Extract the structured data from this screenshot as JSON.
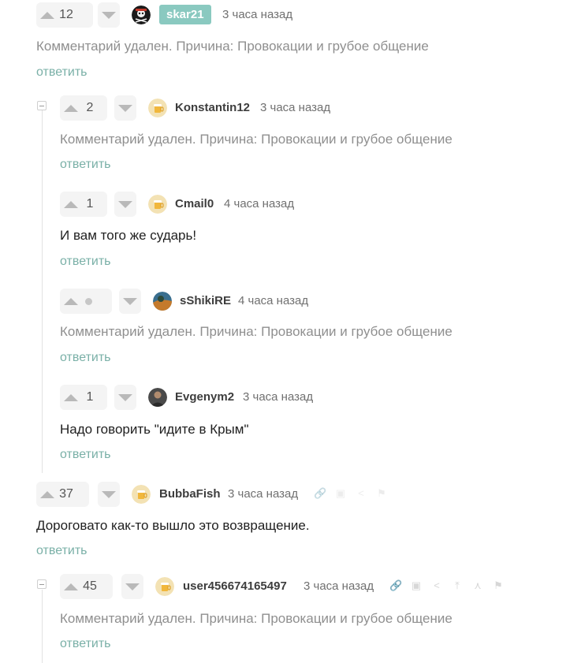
{
  "comments": [
    {
      "rating": "12",
      "user": "skar21",
      "time": "3 часа назад",
      "text": "Комментарий удален. Причина: Провокации и грубое общение",
      "reply": "ответить"
    },
    {
      "rating": "2",
      "user": "Konstantin12",
      "time": "3 часа назад",
      "text": "Комментарий удален. Причина: Провокации и грубое общение",
      "reply": "ответить"
    },
    {
      "rating": "1",
      "user": "Cmail0",
      "time": "4 часа назад",
      "text": "И вам того же сударь!",
      "reply": "ответить"
    },
    {
      "rating": "",
      "user": "sShikiRE",
      "time": "4 часа назад",
      "text": "Комментарий удален. Причина: Провокации и грубое общение",
      "reply": "ответить"
    },
    {
      "rating": "1",
      "user": "Evgenym2",
      "time": "3 часа назад",
      "text": "Надо говорить \"идите в Крым\"",
      "reply": "ответить"
    },
    {
      "rating": "37",
      "user": "BubbaFish",
      "time": "3 часа назад",
      "text": "Дороговато как-то вышло это возвращение.",
      "reply": "ответить"
    },
    {
      "rating": "45",
      "user": "user456674165497",
      "time": "3 часа назад",
      "text": "Комментарий удален. Причина: Провокации и грубое общение",
      "reply": "ответить"
    }
  ],
  "tools": {
    "link": "🔗",
    "save": "▣",
    "share": "<",
    "up": "⤒",
    "branch": "⋏",
    "flag": "⚑"
  },
  "colors": {
    "accent": "#8ac9c0",
    "reply": "#7ab0a7"
  }
}
